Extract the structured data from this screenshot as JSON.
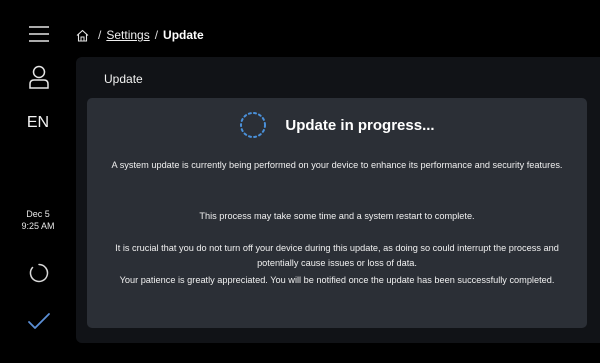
{
  "sidebar": {
    "menu_icon": "hamburger-menu-icon",
    "user_icon": "user-profile-icon",
    "language": "EN",
    "date": "Dec 5",
    "time": "9:25 AM",
    "status_icon": "loading-spinner-icon",
    "confirm_icon": "checkmark-icon"
  },
  "breadcrumb": {
    "home_icon": "home-icon",
    "separator": "/",
    "settings": "Settings",
    "current": "Update"
  },
  "main": {
    "section_title": "Update",
    "card": {
      "title": "Update in progress...",
      "paragraph1": "A system update is currently being performed on your device to enhance its performance and security features.",
      "paragraph2": "This process may take some time and a system restart to complete.",
      "paragraph3": "It is crucial that you do not turn off your device during this update, as doing so could interrupt the process and potentially cause issues or loss of data.",
      "paragraph4": "Your patience is greatly appreciated. You will be notified once the update has been successfully completed."
    }
  },
  "colors": {
    "background": "#000000",
    "panel": "#111317",
    "card": "#2b2f36",
    "spinner_accent": "#4a90d9",
    "check": "#5b8fd6"
  }
}
